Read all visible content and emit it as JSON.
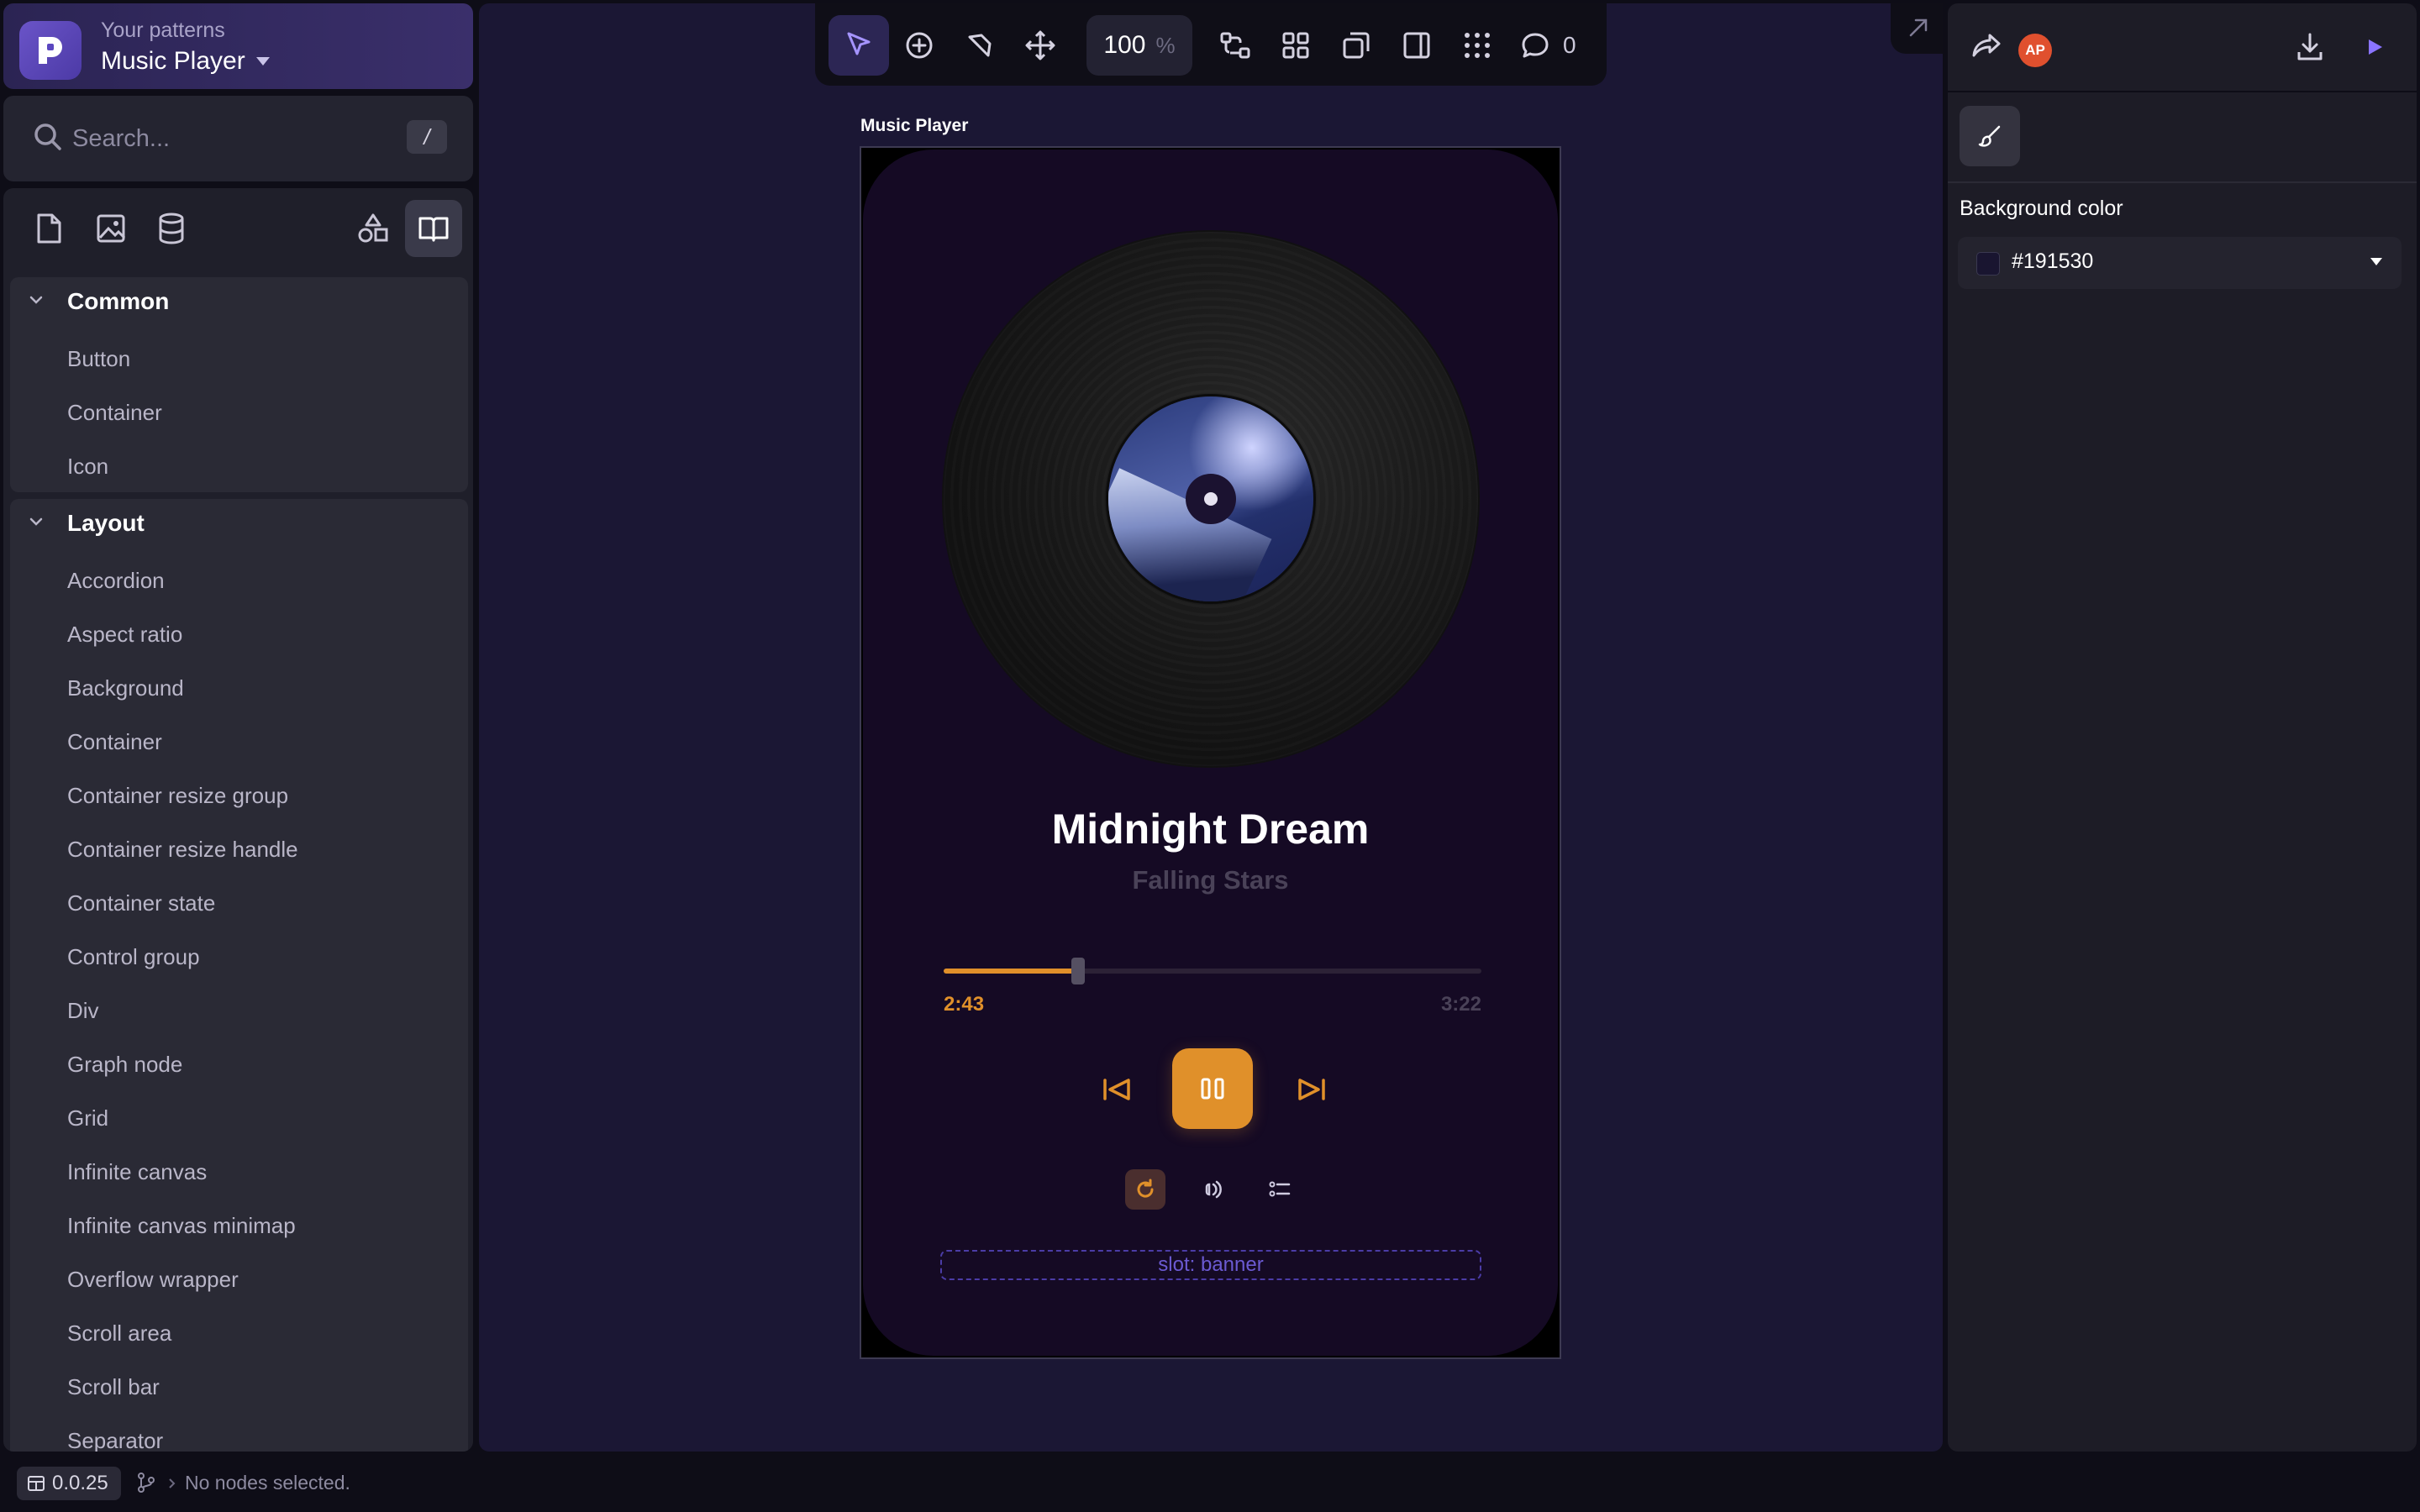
{
  "project": {
    "subtitle": "Your patterns",
    "title": "Music Player"
  },
  "search": {
    "placeholder": "Search...",
    "shortcut": "/"
  },
  "library_tabs": [
    "pages-icon",
    "image-icon",
    "database-icon",
    "shapes-icon",
    "book-icon"
  ],
  "groups": [
    {
      "title": "Common",
      "items": [
        "Button",
        "Container",
        "Icon"
      ]
    },
    {
      "title": "Layout",
      "items": [
        "Accordion",
        "Aspect ratio",
        "Background",
        "Container",
        "Container resize group",
        "Container resize handle",
        "Container state",
        "Control group",
        "Div",
        "Graph node",
        "Grid",
        "Infinite canvas",
        "Infinite canvas minimap",
        "Overflow wrapper",
        "Scroll area",
        "Scroll bar",
        "Separator"
      ]
    }
  ],
  "toolbar": {
    "zoom_value": "100",
    "zoom_unit": "%",
    "comment_count": "0"
  },
  "frame": {
    "label": "Music Player"
  },
  "player": {
    "song_title": "Midnight Dream",
    "artist": "Falling Stars",
    "current_time": "2:43",
    "duration": "3:22",
    "progress": 0.25,
    "slot_label": "slot: banner"
  },
  "right_panel": {
    "avatar_initials": "AP",
    "bg_color_label": "Background color",
    "bg_color_value": "#191530"
  },
  "status": {
    "version": "0.0.25",
    "selection_text": "No nodes selected."
  },
  "colors": {
    "accent": "#e0902a",
    "brand": "#5b47c0",
    "avatar": "#e0502e",
    "frame_bg": "#191530"
  }
}
